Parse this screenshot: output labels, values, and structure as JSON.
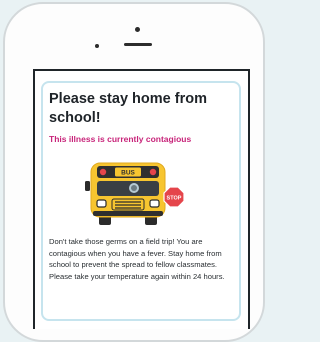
{
  "alert": {
    "title": "Please stay home from school!",
    "subtitle": "This illness is currently contagious",
    "body": "Don't take those germs on a field trip! You are contagious when you have a fever. Stay home from school to prevent the spread to fellow classmates. Please take your temperature again within 24 hours."
  },
  "illustration": {
    "bus_sign": "BUS",
    "stop_sign": "STOP",
    "icon": "school-bus-icon"
  },
  "colors": {
    "title": "#1e2328",
    "subtitle": "#c8247a",
    "card_border": "#c6e4ee",
    "bus": "#f7c530",
    "stop_sign": "#e5454b",
    "background": "#e9f2f4"
  }
}
